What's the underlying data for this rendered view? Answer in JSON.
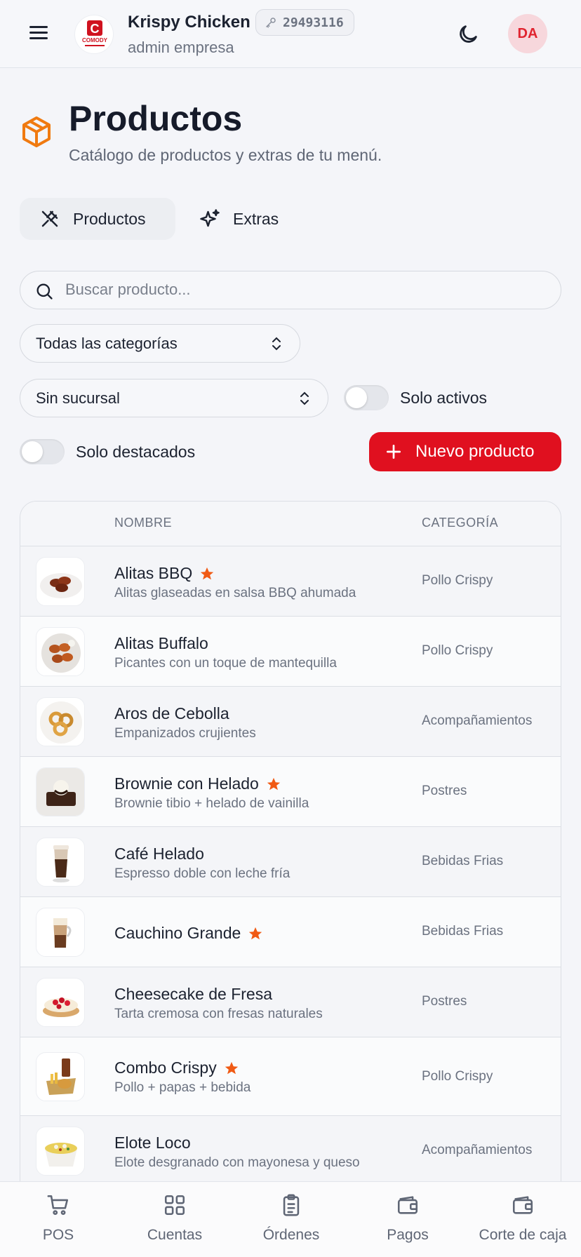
{
  "header": {
    "brand_name": "Krispy Chicken",
    "brand_sub": "admin empresa",
    "badge_code": "29493116",
    "avatar_initials": "DA",
    "logo_text": "COMODY"
  },
  "page": {
    "title": "Productos",
    "subtitle": "Catálogo de productos y extras de tu menú."
  },
  "tabs": [
    {
      "label": "Productos",
      "active": true
    },
    {
      "label": "Extras",
      "active": false
    }
  ],
  "filters": {
    "search_placeholder": "Buscar producto...",
    "category_select": "Todas las categorías",
    "branch_select": "Sin sucursal",
    "only_active_label": "Solo activos",
    "only_featured_label": "Solo destacados",
    "new_button_label": "Nuevo producto"
  },
  "table": {
    "columns": [
      "NOMBRE",
      "CATEGORÍA"
    ],
    "rows": [
      {
        "name": "Alitas BBQ",
        "desc": "Alitas glaseadas en salsa BBQ ahumada",
        "category": "Pollo Crispy",
        "featured": true
      },
      {
        "name": "Alitas Buffalo",
        "desc": "Picantes con un toque de mantequilla",
        "category": "Pollo Crispy",
        "featured": false
      },
      {
        "name": "Aros de Cebolla",
        "desc": "Empanizados crujientes",
        "category": "Acompañamientos",
        "featured": false
      },
      {
        "name": "Brownie con Helado",
        "desc": "Brownie tibio + helado de vainilla",
        "category": "Postres",
        "featured": true
      },
      {
        "name": "Café Helado",
        "desc": "Espresso doble con leche fría",
        "category": "Bebidas Frias",
        "featured": false
      },
      {
        "name": "Cauchino Grande",
        "desc": "",
        "category": "Bebidas Frias",
        "featured": true
      },
      {
        "name": "Cheesecake de Fresa",
        "desc": "Tarta cremosa con fresas naturales",
        "category": "Postres",
        "featured": false
      },
      {
        "name": "Combo Crispy",
        "desc": "Pollo + papas + bebida",
        "category": "Pollo Crispy",
        "featured": true
      },
      {
        "name": "Elote Loco",
        "desc": "Elote desgranado con mayonesa y queso",
        "category": "Acompañamientos",
        "featured": false
      }
    ]
  },
  "bottom_nav": [
    {
      "label": "POS",
      "icon": "cart-icon"
    },
    {
      "label": "Cuentas",
      "icon": "grid-icon"
    },
    {
      "label": "Órdenes",
      "icon": "clipboard-icon"
    },
    {
      "label": "Pagos",
      "icon": "wallet-icon"
    },
    {
      "label": "Corte de caja",
      "icon": "wallet-icon"
    }
  ],
  "colors": {
    "accent": "#e0101f",
    "star": "#f05a14",
    "title_icon": "#f07a10",
    "avatar_bg": "#f7d7dc"
  }
}
